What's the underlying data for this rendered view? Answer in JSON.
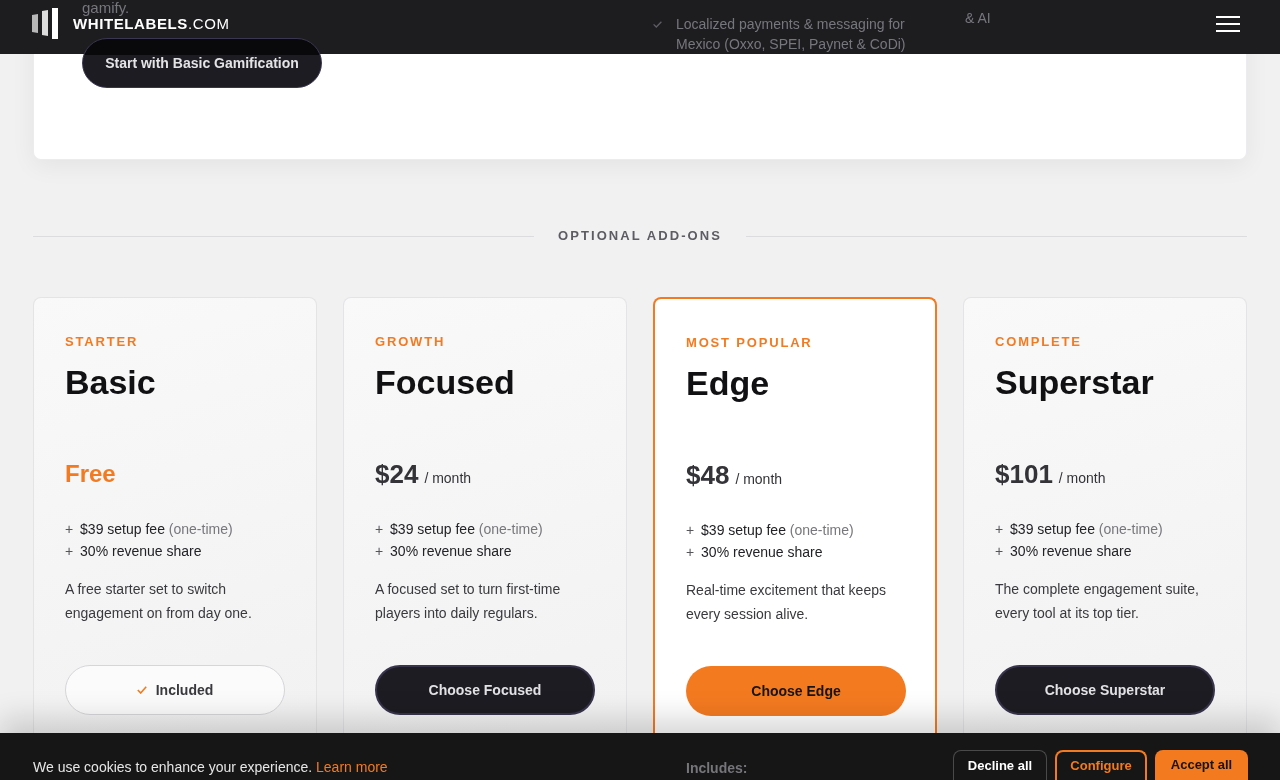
{
  "header": {
    "logo": "**WHITELABELS**.COM"
  },
  "plan_card": {
    "description_tail": "gamify.",
    "cta": "Start with Basic Gamification",
    "features": [
      "Localized payments & messaging for Mexico (Oxxo, SPEI, Paynet & CoDi)"
    ],
    "support_tail": "& AI"
  },
  "section_title": "OPTIONAL ADD-ONS",
  "addons": [
    {
      "tier": "STARTER",
      "name": "Basic",
      "highlighted": false,
      "price": {
        "kind": "free",
        "amount": "Free"
      },
      "fees": [
        {
          "marker": "+",
          "text": "$39 setup fee",
          "note": "(one-time)"
        },
        {
          "marker": "+",
          "text": "30% revenue share"
        }
      ],
      "description": "A free starter set to switch engagement on from day one.",
      "button": {
        "kind": "included",
        "label": "Included"
      }
    },
    {
      "tier": "GROWTH",
      "name": "Focused",
      "highlighted": false,
      "price": {
        "kind": "paid",
        "amount": "$24",
        "period": "/ month"
      },
      "fees": [
        {
          "marker": "+",
          "text": "$39 setup fee",
          "note": "(one-time)"
        },
        {
          "marker": "+",
          "text": "30% revenue share"
        }
      ],
      "description": "A focused set to turn first-time players into daily regulars.",
      "button": {
        "kind": "dark",
        "label": "Choose Focused"
      }
    },
    {
      "tier": "MOST POPULAR",
      "name": "Edge",
      "highlighted": true,
      "price": {
        "kind": "paid",
        "amount": "$48",
        "period": "/ month"
      },
      "fees": [
        {
          "marker": "+",
          "text": "$39 setup fee",
          "note": "(one-time)"
        },
        {
          "marker": "+",
          "text": "30% revenue share"
        }
      ],
      "description": "Real-time excitement that keeps every session alive.",
      "button": {
        "kind": "accent",
        "label": "Choose Edge"
      },
      "includes_label": "Includes:"
    },
    {
      "tier": "COMPLETE",
      "name": "Superstar",
      "highlighted": false,
      "price": {
        "kind": "paid",
        "amount": "$101",
        "period": "/ month"
      },
      "fees": [
        {
          "marker": "+",
          "text": "$39 setup fee",
          "note": "(one-time)"
        },
        {
          "marker": "+",
          "text": "30% revenue share"
        }
      ],
      "description": "The complete engagement suite, every tool at its top tier.",
      "button": {
        "kind": "dark",
        "label": "Choose Superstar"
      }
    }
  ],
  "cookie_banner": {
    "message": "We use cookies to enhance your experience.",
    "link": "Learn more",
    "buttons": [
      {
        "kind": "outline",
        "label": "Decline all"
      },
      {
        "kind": "accent_outline",
        "label": "Configure"
      },
      {
        "kind": "accent",
        "label": "Accept all"
      }
    ]
  }
}
